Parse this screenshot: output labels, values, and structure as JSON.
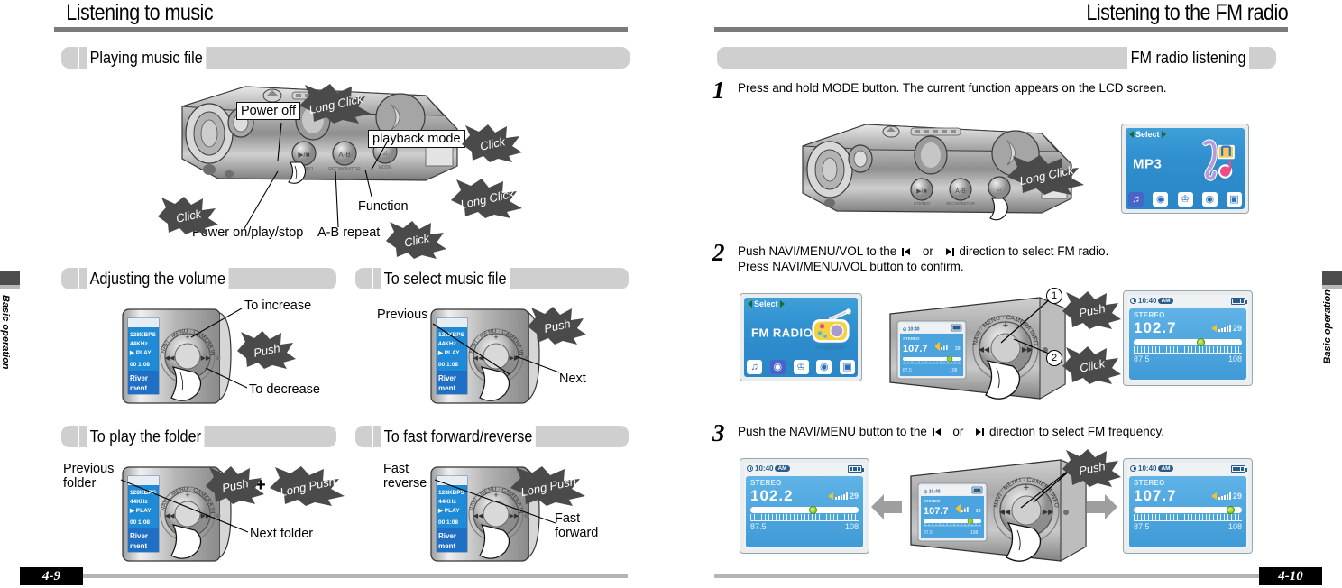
{
  "left_page": {
    "title": "Listening to music",
    "side_tab_label": "Basic operation",
    "page_number": "4-9",
    "sections": [
      {
        "id": "playing-music-file",
        "label": "Playing music file",
        "callouts": [
          {
            "name": "power-off",
            "text": "Power off"
          },
          {
            "name": "playback-mode",
            "text": "playback mode"
          },
          {
            "name": "function",
            "text": "Function"
          },
          {
            "name": "power-on-play-stop",
            "text": "Power on/play/stop"
          },
          {
            "name": "ab-repeat",
            "text": "A-B repeat"
          }
        ],
        "bursts": [
          {
            "name": "long-click-1",
            "text": "Long Click"
          },
          {
            "name": "click-1",
            "text": "Click"
          },
          {
            "name": "long-click-2",
            "text": "Long Click"
          },
          {
            "name": "click-2",
            "text": "Click"
          },
          {
            "name": "click-3",
            "text": "Click"
          }
        ]
      },
      {
        "id": "adjusting-the-volume",
        "label": "Adjusting the volume",
        "callouts": [
          {
            "name": "to-increase",
            "text": "To increase"
          },
          {
            "name": "to-decrease",
            "text": "To decrease"
          }
        ],
        "bursts": [
          {
            "name": "push",
            "text": "Push"
          }
        ]
      },
      {
        "id": "to-select-music-file",
        "label": "To select music file",
        "callouts": [
          {
            "name": "previous",
            "text": "Previous"
          },
          {
            "name": "next",
            "text": "Next"
          }
        ],
        "bursts": [
          {
            "name": "push",
            "text": "Push"
          }
        ]
      },
      {
        "id": "to-play-the-folder",
        "label": "To play the  folder",
        "callouts": [
          {
            "name": "previous-folder",
            "text": "Previous\nfolder"
          },
          {
            "name": "next-folder",
            "text": "Next folder"
          }
        ],
        "bursts": [
          {
            "name": "push",
            "text": "Push"
          },
          {
            "name": "long-push",
            "text": "Long Push"
          }
        ],
        "operator": "+"
      },
      {
        "id": "to-fast-forward-reverse",
        "label": "To fast forward/reverse",
        "callouts": [
          {
            "name": "fast-reverse",
            "text": "Fast\nreverse"
          },
          {
            "name": "fast-forward",
            "text": "Fast\nforward"
          }
        ],
        "bursts": [
          {
            "name": "long-push",
            "text": "Long Push"
          }
        ]
      }
    ],
    "device_lcd_text": {
      "bitrate": "128KBPS",
      "samplerate": "44KHz",
      "state": "PLAY",
      "time": "00 1:08",
      "track_line1": "River",
      "track_line2": "ment"
    },
    "wheel_label": "NAVI • MENU • CAMERA INFO",
    "device_button_labels": {
      "play": "▶/■",
      "ab": "A-B",
      "mode": "MODE"
    }
  },
  "right_page": {
    "title": "Listening to the FM radio",
    "side_tab_label": "Basic operation",
    "page_number": "4-10",
    "section_label": "FM radio listening",
    "steps": [
      {
        "number": "1",
        "text": "Press and hold MODE button. The current function appears on the LCD screen.",
        "bursts": [
          {
            "name": "long-click",
            "text": "Long Click"
          }
        ]
      },
      {
        "number": "2",
        "line1_before": "Push NAVI/MENU/VOL to the",
        "line1_mid": "or",
        "line1_after": "direction to select FM radio.",
        "line2": "Press NAVI/MENU/VOL button to confirm.",
        "bursts": [
          {
            "name": "push",
            "text": "Push"
          },
          {
            "name": "click",
            "text": "Click"
          }
        ],
        "markers": [
          "1",
          "2"
        ]
      },
      {
        "number": "3",
        "line1_before": "Push the NAVI/MENU button to the",
        "line1_mid": "or",
        "line1_after": "direction to select FM frequency.",
        "bursts": [
          {
            "name": "push",
            "text": "Push"
          }
        ]
      }
    ],
    "lcd_menu_mp3": {
      "select_label": "Select",
      "title": "MP3",
      "icons": [
        "music-note-icon",
        "radio-icon",
        "microphone-icon",
        "camera-icon",
        "photo-album-icon"
      ],
      "selected_icon_index": 0
    },
    "lcd_menu_fm": {
      "select_label": "Select",
      "title": "FM RADIO",
      "icons": [
        "music-note-icon",
        "radio-icon",
        "microphone-icon",
        "camera-icon",
        "photo-album-icon"
      ],
      "selected_icon_index": 1
    },
    "lcd_fm_screens": [
      {
        "name": "step2-result",
        "clock": "10:40",
        "ampm": "AM",
        "stereo": "STEREO",
        "frequency": "102.7",
        "volume": "29",
        "band_min": "87.5",
        "band_max": "108",
        "knob_pct": 58
      },
      {
        "name": "step3-before",
        "clock": "10:40",
        "ampm": "AM",
        "stereo": "STEREO",
        "frequency": "102.2",
        "volume": "29",
        "band_min": "87.5",
        "band_max": "108",
        "knob_pct": 54
      },
      {
        "name": "step3-device",
        "clock": "10:40",
        "ampm": "AM",
        "stereo": "STEREO",
        "frequency": "107.7",
        "volume": "29",
        "band_min": "87.5",
        "band_max": "108",
        "knob_pct": 82
      },
      {
        "name": "step3-after",
        "clock": "10:40",
        "ampm": "AM",
        "stereo": "STEREO",
        "frequency": "107.7",
        "volume": "29",
        "band_min": "87.5",
        "band_max": "108",
        "knob_pct": 86
      },
      {
        "name": "step2-device",
        "clock": "10:40",
        "ampm": "AM",
        "stereo": "STEREO",
        "frequency": "107.7",
        "volume": "29",
        "band_min": "87.5",
        "band_max": "108",
        "knob_pct": 82
      }
    ],
    "wheel_label": "NAVI • MENU • CAMERA INFO"
  },
  "colors": {
    "rule_grey": "#7a7a7a",
    "pill_grey": "#cfcfcf",
    "foot_grey": "#b5b5b5",
    "lcd_blue": "#3f9ad6",
    "burst_grey": "#4a4a4a",
    "black": "#000000"
  }
}
